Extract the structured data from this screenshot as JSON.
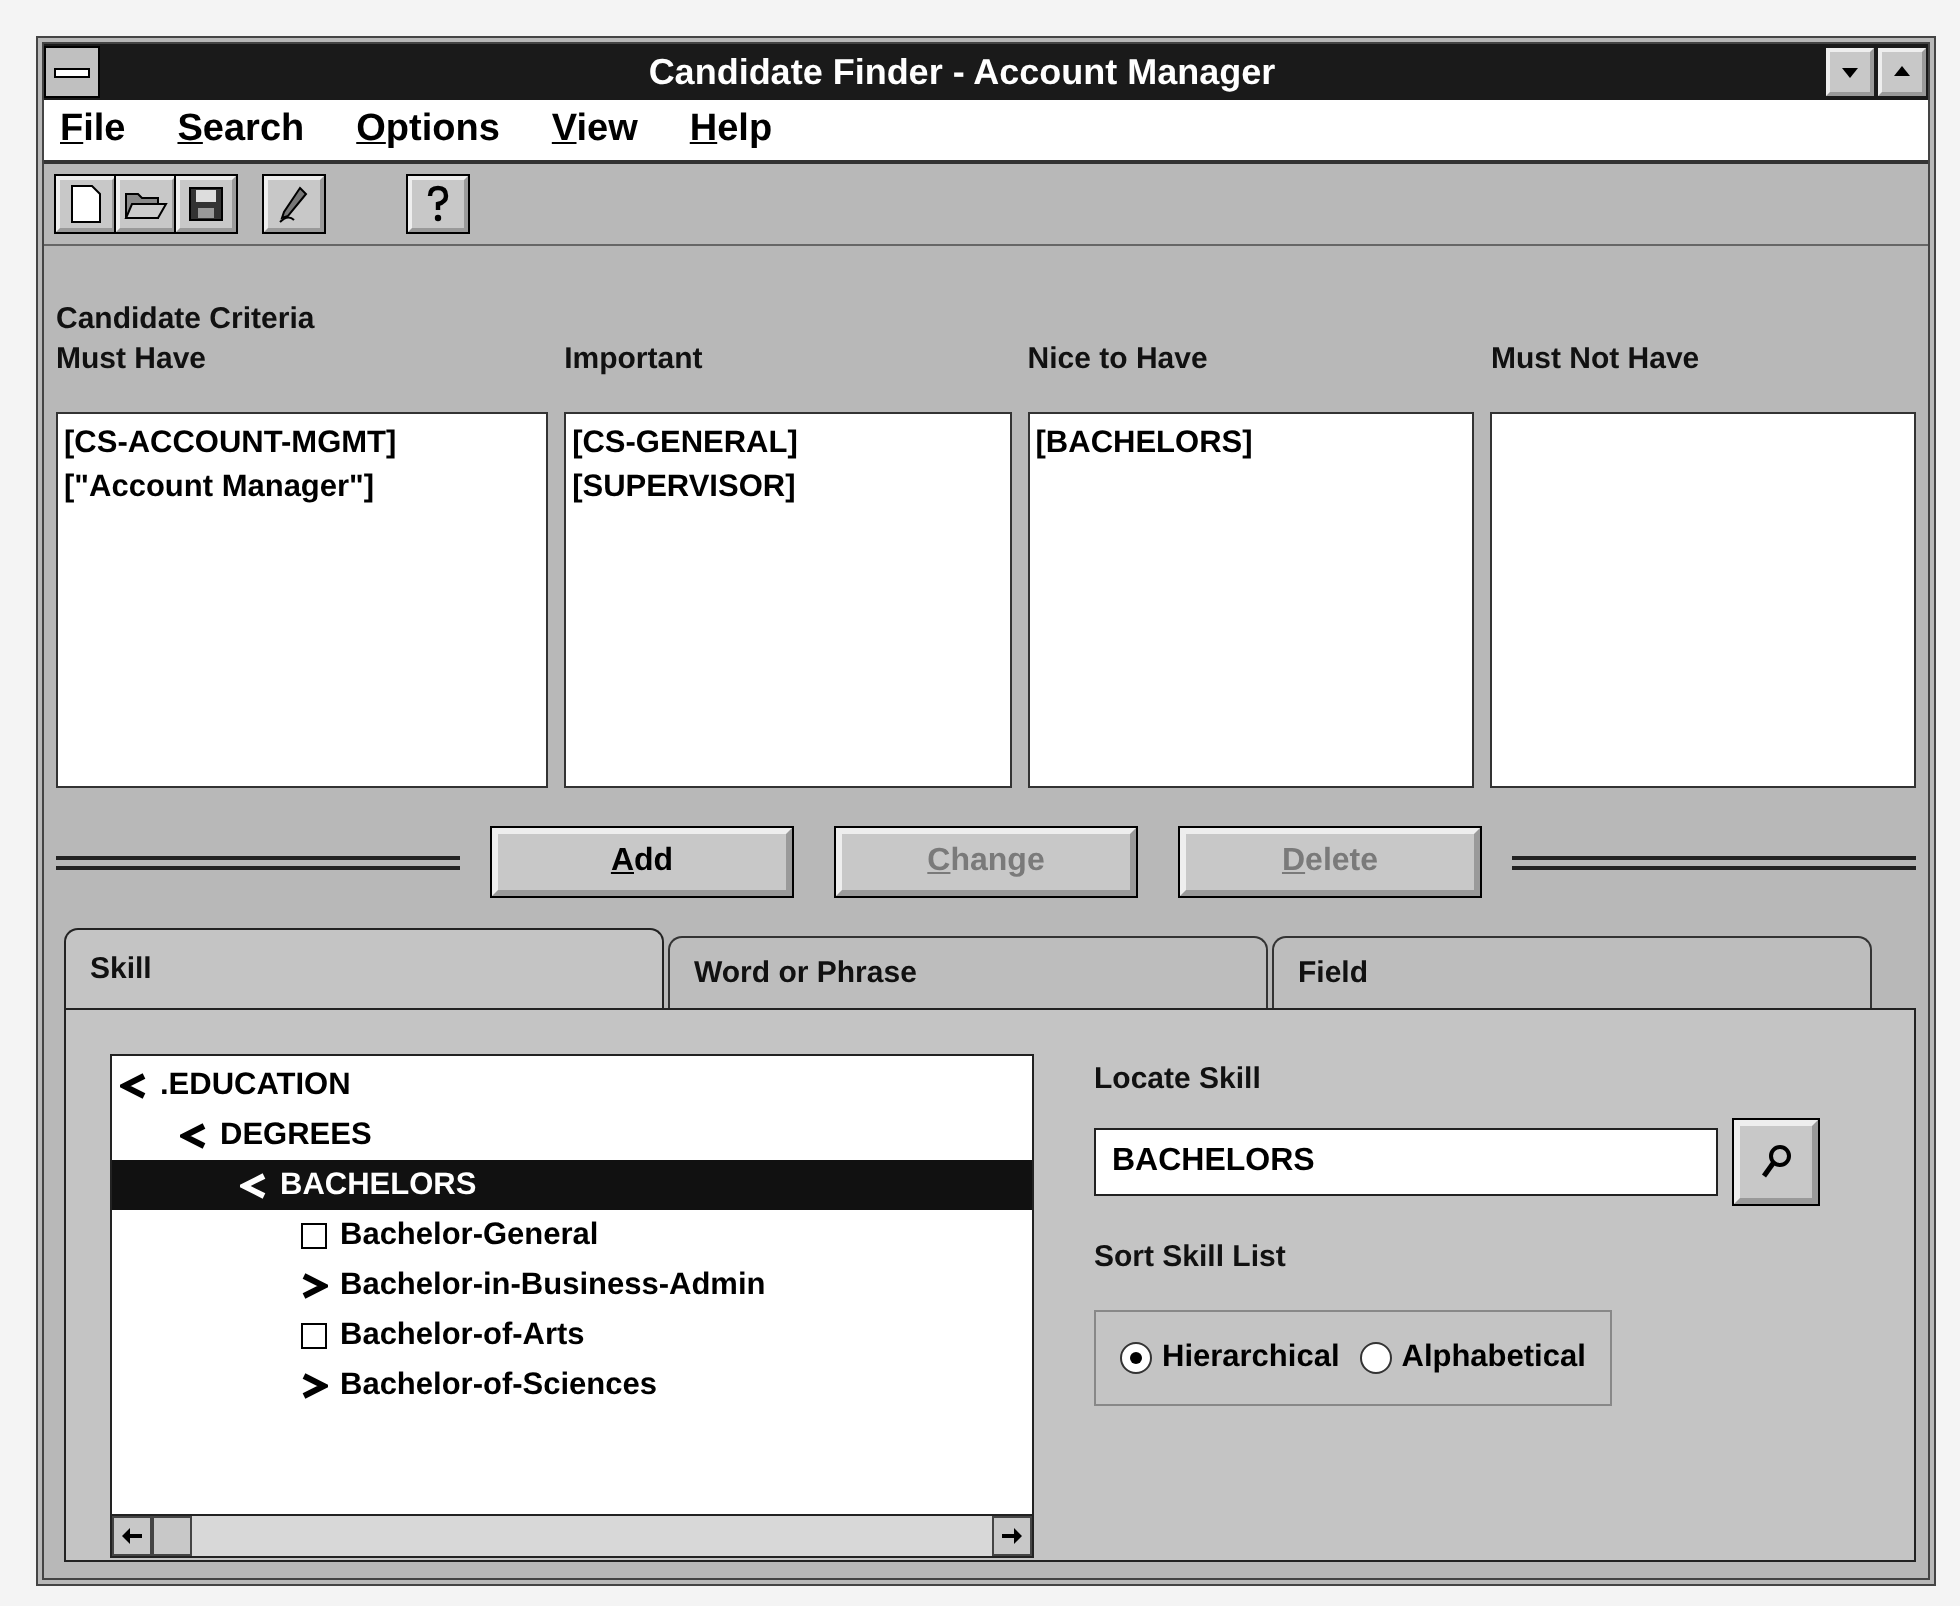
{
  "window": {
    "title": "Candidate Finder - Account Manager"
  },
  "menu": [
    {
      "label": "File"
    },
    {
      "label": "Search"
    },
    {
      "label": "Options"
    },
    {
      "label": "View"
    },
    {
      "label": "Help"
    }
  ],
  "criteria": {
    "title": "Candidate Criteria",
    "columns": [
      {
        "heading": "Must Have",
        "items": [
          "[CS-ACCOUNT-MGMT]",
          "[\"Account Manager\"]"
        ]
      },
      {
        "heading": "Important",
        "items": [
          "[CS-GENERAL]",
          "[SUPERVISOR]"
        ]
      },
      {
        "heading": "Nice to Have",
        "items": [
          "[BACHELORS]"
        ]
      },
      {
        "heading": "Must Not Have"
      }
    ]
  },
  "buttons": [
    {
      "label": "Add",
      "disabled": false
    },
    {
      "label": "Change",
      "disabled": true
    },
    {
      "label": "Delete",
      "disabled": true
    }
  ],
  "tabs": [
    {
      "label": "Skill",
      "selected": true
    },
    {
      "label": "Word or Phrase",
      "selected": false
    },
    {
      "label": "Field",
      "selected": false
    }
  ],
  "tree": [
    {
      "label": ".EDUCATION",
      "kind": "node",
      "expanded": true,
      "selected": false,
      "children": [
        {
          "label": "DEGREES",
          "kind": "node",
          "expanded": true,
          "selected": false,
          "children": [
            {
              "label": "BACHELORS",
              "kind": "node",
              "expanded": true,
              "selected": true,
              "children": [
                {
                  "label": "Bachelor-General",
                  "kind": "leaf",
                  "selected": false
                },
                {
                  "label": "Bachelor-in-Business-Admin",
                  "kind": "node",
                  "expanded": false,
                  "selected": false
                },
                {
                  "label": "Bachelor-of-Arts",
                  "kind": "leaf",
                  "selected": false
                },
                {
                  "label": "Bachelor-of-Sciences",
                  "kind": "node",
                  "expanded": false,
                  "selected": false
                }
              ]
            }
          ]
        }
      ]
    }
  ],
  "locate": {
    "label": "Locate Skill",
    "value": "BACHELORS"
  },
  "sort": {
    "label": "Sort Skill List",
    "options": [
      {
        "label": "Hierarchical",
        "selected": true
      },
      {
        "label": "Alphabetical",
        "selected": false
      }
    ]
  }
}
